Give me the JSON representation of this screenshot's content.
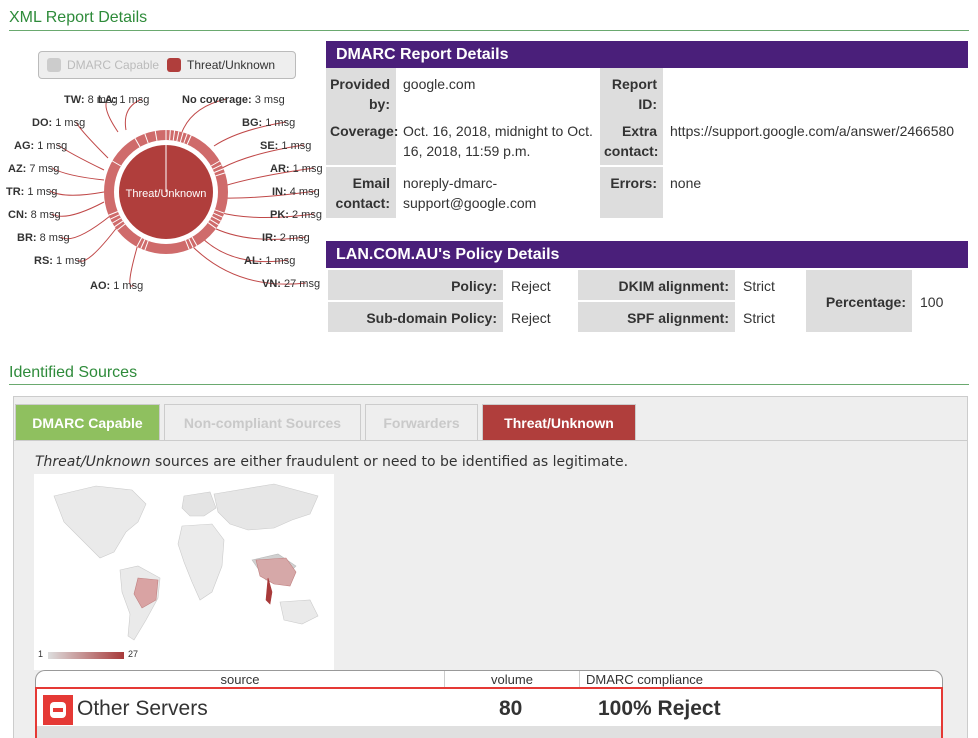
{
  "report_section": {
    "title": "XML Report Details"
  },
  "legend": [
    {
      "label": "DMARC Capable",
      "color": "#cccccc",
      "active": false
    },
    {
      "label": "Threat/Unknown",
      "color": "#b03e3c",
      "active": true
    }
  ],
  "donut": {
    "center_label": "Threat/Unknown",
    "colors": {
      "inner": "#b03e3c",
      "outer": "#cf6b6b",
      "line": "#c04848"
    },
    "labels": [
      {
        "code": "TW:",
        "text": "8 msg"
      },
      {
        "code": "LA:",
        "text": "1 msg"
      },
      {
        "code": "DO:",
        "text": "1 msg"
      },
      {
        "code": "AG:",
        "text": "1 msg"
      },
      {
        "code": "AZ:",
        "text": "7 msg"
      },
      {
        "code": "TR:",
        "text": "1 msg"
      },
      {
        "code": "CN:",
        "text": "8 msg"
      },
      {
        "code": "BR:",
        "text": "8 msg"
      },
      {
        "code": "RS:",
        "text": "1 msg"
      },
      {
        "code": "AO:",
        "text": "1 msg"
      },
      {
        "code": "No coverage:",
        "text": "3 msg"
      },
      {
        "code": "BG:",
        "text": "1 msg"
      },
      {
        "code": "SE:",
        "text": "1 msg"
      },
      {
        "code": "AR:",
        "text": "1 msg"
      },
      {
        "code": "IN:",
        "text": "4 msg"
      },
      {
        "code": "PK:",
        "text": "2 msg"
      },
      {
        "code": "IR:",
        "text": "2 msg"
      },
      {
        "code": "AL:",
        "text": "1 msg"
      },
      {
        "code": "VN:",
        "text": "27 msg"
      }
    ]
  },
  "dmarc_report": {
    "title": "DMARC Report Details",
    "provided_by_label": "Provided by:",
    "provided_by": "google.com",
    "report_id_label": "Report ID:",
    "report_id": "",
    "coverage_label": "Coverage:",
    "coverage": "Oct. 16, 2018, midnight to Oct. 16, 2018, 11:59 p.m.",
    "extra_contact_label": "Extra contact:",
    "extra_contact": "https://support.google.com/a/answer/2466580",
    "email_contact_label": "Email contact:",
    "email_contact": "noreply-dmarc-support@google.com",
    "errors_label": "Errors:",
    "errors": "none"
  },
  "policy": {
    "title": "LAN.COM.AU's Policy Details",
    "policy_label": "Policy:",
    "policy": "Reject",
    "subdomain_label": "Sub-domain Policy:",
    "subdomain": "Reject",
    "dkim_label": "DKIM alignment:",
    "dkim": "Strict",
    "spf_label": "SPF alignment:",
    "spf": "Strict",
    "percentage_label": "Percentage:",
    "percentage": "100"
  },
  "sources_section": {
    "title": "Identified Sources"
  },
  "tabs": [
    {
      "label": "DMARC Capable",
      "state": "green"
    },
    {
      "label": "Non-compliant Sources",
      "state": "dim"
    },
    {
      "label": "Forwarders",
      "state": "dim"
    },
    {
      "label": "Threat/Unknown",
      "state": "red"
    }
  ],
  "description": {
    "emph": "Threat/Unknown",
    "rest": " sources are either fraudulent or need to be identified as legitimate."
  },
  "map": {
    "scale_min": "1",
    "scale_max": "27",
    "color_low": "#dddddd",
    "color_high": "#a83a3a"
  },
  "table": {
    "columns": [
      "source",
      "volume",
      "DMARC compliance"
    ],
    "rows": [
      {
        "source": "Other Servers",
        "volume": "80",
        "compliance": "100% Reject"
      }
    ]
  }
}
